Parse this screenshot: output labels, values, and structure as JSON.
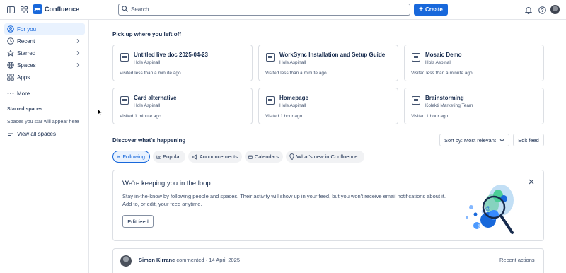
{
  "app": {
    "title": "Confluence",
    "accent": "#1868db"
  },
  "search": {
    "placeholder": "Search"
  },
  "header": {
    "create_label": "Create"
  },
  "sidebar": {
    "items": [
      {
        "label": "For you",
        "icon": "for-you-icon"
      },
      {
        "label": "Recent",
        "icon": "clock-icon"
      },
      {
        "label": "Starred",
        "icon": "star-icon"
      },
      {
        "label": "Spaces",
        "icon": "globe-icon"
      },
      {
        "label": "Apps",
        "icon": "apps-icon"
      },
      {
        "label": "More",
        "icon": "ellipsis-icon"
      }
    ],
    "starred_title": "Starred spaces",
    "starred_hint": "Spaces you star will appear here",
    "view_all": "View all spaces"
  },
  "main": {
    "recent_title": "Pick up where you left off",
    "cards": [
      {
        "title": "Untitled live doc 2025-04-23",
        "sub": "Hols Aspinall",
        "time": "Visited less than a minute ago",
        "icon": "live-doc-icon"
      },
      {
        "title": "WorkSync Installation and Setup Guide",
        "sub": "Hols Aspinall",
        "time": "Visited less than a minute ago",
        "icon": "page-icon"
      },
      {
        "title": "Mosaic Demo",
        "sub": "Hols Aspinall",
        "time": "Visited less than a minute ago",
        "icon": "page-icon"
      },
      {
        "title": "Card alternative",
        "sub": "Hols Aspinall",
        "time": "Visited 1 minute ago",
        "icon": "page-icon"
      },
      {
        "title": "Homepage",
        "sub": "Hols Aspinall",
        "time": "Visited 1 hour ago",
        "icon": "page-icon"
      },
      {
        "title": "Brainstorming",
        "sub": "Kolekti Marketing Team",
        "time": "Visited 1 hour ago",
        "icon": "page-icon"
      }
    ],
    "discover_title": "Discover what's happening",
    "sort_label": "Sort by: Most relevant",
    "edit_feed_label": "Edit feed",
    "tabs": [
      {
        "label": "Following",
        "icon": "people-icon"
      },
      {
        "label": "Popular",
        "icon": "chart-icon"
      },
      {
        "label": "Announcements",
        "icon": "megaphone-icon"
      },
      {
        "label": "Calendars",
        "icon": "calendar-icon"
      },
      {
        "label": "What's new in Confluence",
        "icon": "lightbulb-icon"
      }
    ],
    "loop": {
      "title": "We're keeping you in the loop",
      "text": "Stay in-the-know by following people and spaces. Their activity will show up in your feed, but you won't receive email notifications about it. Add to, or edit, your feed anytime.",
      "button": "Edit feed"
    },
    "activity": {
      "author": "Simon Kirrane",
      "action": "commented",
      "date": "14 April 2025",
      "recent_actions": "Recent actions"
    }
  }
}
